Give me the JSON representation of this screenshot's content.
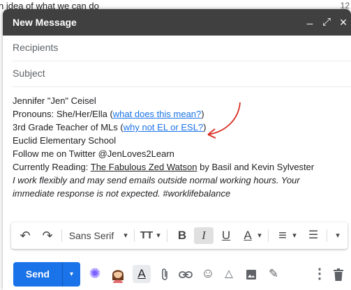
{
  "background": {
    "email_subject_snippet": "n idea of what we can do",
    "time": "12"
  },
  "compose": {
    "title": "New Message",
    "window_buttons": {
      "minimize": "_",
      "popout": "⤢",
      "close": "×"
    },
    "recipients_placeholder": "Recipients",
    "subject_placeholder": "Subject",
    "signature": {
      "name": "Jennifer \"Jen\" Ceisel",
      "pronouns_prefix": "Pronouns: She/Her/Ella (",
      "pronouns_link": "what does this mean?",
      "pronouns_suffix": ")",
      "role_prefix": "3rd Grade Teacher of MLs (",
      "role_link": "why not EL or ESL?",
      "role_suffix": ")",
      "school": "Euclid Elementary School",
      "twitter": "Follow me on Twitter @JenLoves2Learn",
      "reading_prefix": "Currently Reading: ",
      "reading_title": "The Fabulous Zed Watson",
      "reading_suffix": " by Basil and Kevin Sylvester",
      "note": "I work flexibly and may send emails outside normal working hours. Your immediate response is not expected. #worklifebalance"
    },
    "annotation_color": "#d93025",
    "toolbar": {
      "undo": "↶",
      "redo": "↷",
      "font": "Sans Serif",
      "dropdown": "▾",
      "font_size": "TT",
      "bold": "B",
      "italic": "I",
      "underline": "U",
      "text_color": "A",
      "align": "≡",
      "list": "☰",
      "more": "▾"
    },
    "bottom": {
      "send": "Send",
      "send_options": "▾",
      "icons": [
        "sparkle-icon",
        "avatar",
        "text-format-icon",
        "attach-icon",
        "link-icon",
        "emoji-icon",
        "drive-icon",
        "photo-icon",
        "signature-icon",
        "more-options-icon",
        "delete-icon"
      ]
    }
  },
  "colors": {
    "header_bg": "#404040",
    "link": "#1a73e8",
    "send_bg": "#1a73e8"
  }
}
